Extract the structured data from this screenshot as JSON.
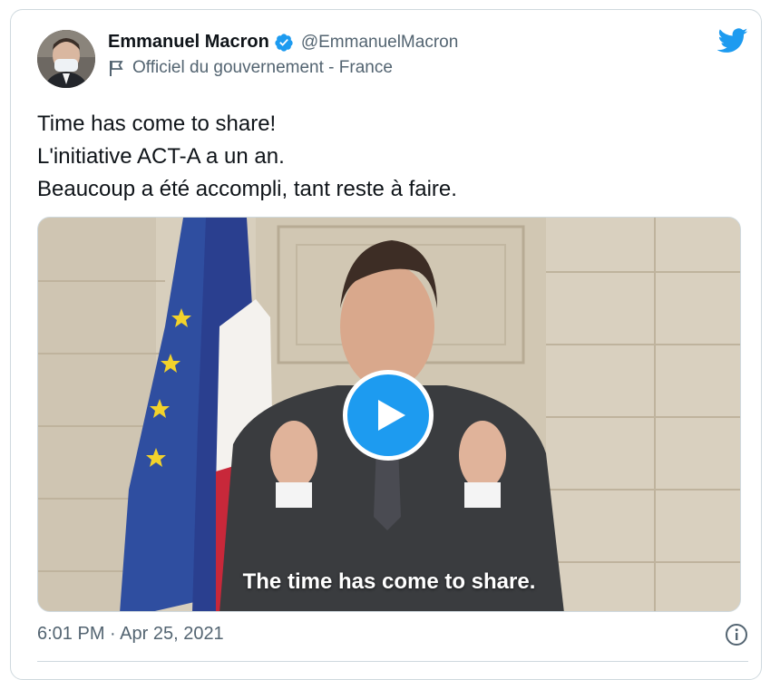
{
  "author": {
    "display_name": "Emmanuel Macron",
    "handle": "@EmmanuelMacron",
    "label": "Officiel du gouvernement - France",
    "verified_icon": "verified-badge-icon",
    "label_icon": "flag-icon"
  },
  "tweet": {
    "text": "Time has come to share!\nL'initiative ACT-A a un an.\nBeaucoup a été accompli, tant reste à faire.",
    "timestamp": "6:01 PM · Apr 25, 2021"
  },
  "media": {
    "type": "video",
    "caption": "The time has come to share.",
    "play_icon": "play-icon"
  },
  "colors": {
    "accent": "#1d9bf0",
    "text_primary": "#0f1419",
    "text_secondary": "#536471",
    "border": "#cfd9de"
  }
}
